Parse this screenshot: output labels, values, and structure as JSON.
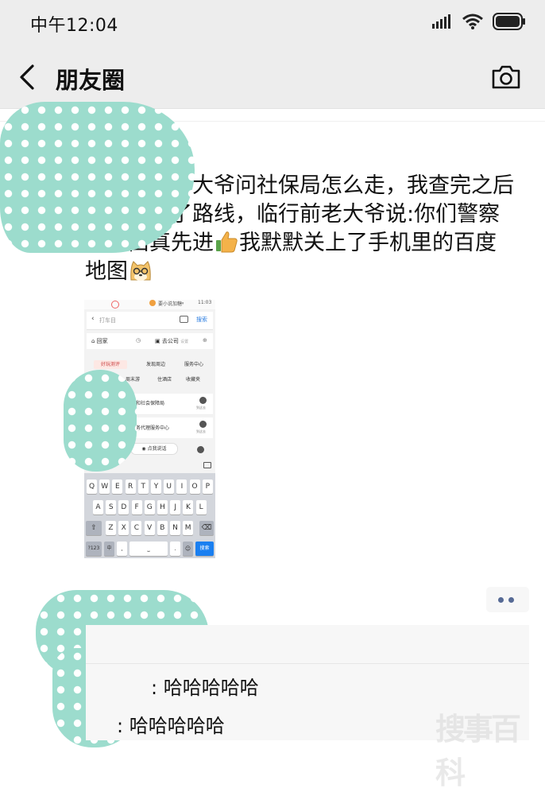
{
  "status_bar": {
    "time": "中午12:04"
  },
  "nav": {
    "title": "朋友圈"
  },
  "post": {
    "text_parts": [
      "上午一位老大爷问社保局怎么走，我查完之后给他指好了路线，临行前老大爷说:你们警察的东西真先进",
      "我默默关上了手机里的百度地图"
    ],
    "emojis": [
      "thumbs-up-icon",
      "doge-face-icon"
    ]
  },
  "phone_screenshot": {
    "status_text": "要小说加糖ᵍ",
    "status_time": "11:03",
    "search_placeholder": "打车目",
    "search_button": "搜索",
    "home": "回家",
    "company": "去公司",
    "company_hint": "设置",
    "chips": [
      "好玩测评",
      "发现周边",
      "服务中心",
      "周末游",
      "住酒店",
      "收藏夹"
    ],
    "results": [
      {
        "name": "市和社会保障局",
        "action": "到这去"
      },
      {
        "name": "事务代理服务中心",
        "action": "到这去"
      }
    ],
    "voice_button": "点我说话",
    "keys_row1": [
      "Q",
      "W",
      "E",
      "R",
      "T",
      "Y",
      "U",
      "I",
      "O",
      "P"
    ],
    "keys_row2": [
      "A",
      "S",
      "D",
      "F",
      "G",
      "H",
      "J",
      "K",
      "L"
    ],
    "keys_row3": [
      "Z",
      "X",
      "C",
      "V",
      "B",
      "N",
      "M"
    ],
    "key_123": "?123",
    "key_lang": "中",
    "key_search": "搜索"
  },
  "comments": [
    {
      "text": ": 哈哈哈哈哈"
    },
    {
      "text": ": 哈哈哈哈哈"
    }
  ],
  "watermark": "搜事百科",
  "colors": {
    "header_bg": "#ededed",
    "mosaic": "#9cdccd",
    "link": "#566a95",
    "key_search": "#1a7ff0"
  }
}
